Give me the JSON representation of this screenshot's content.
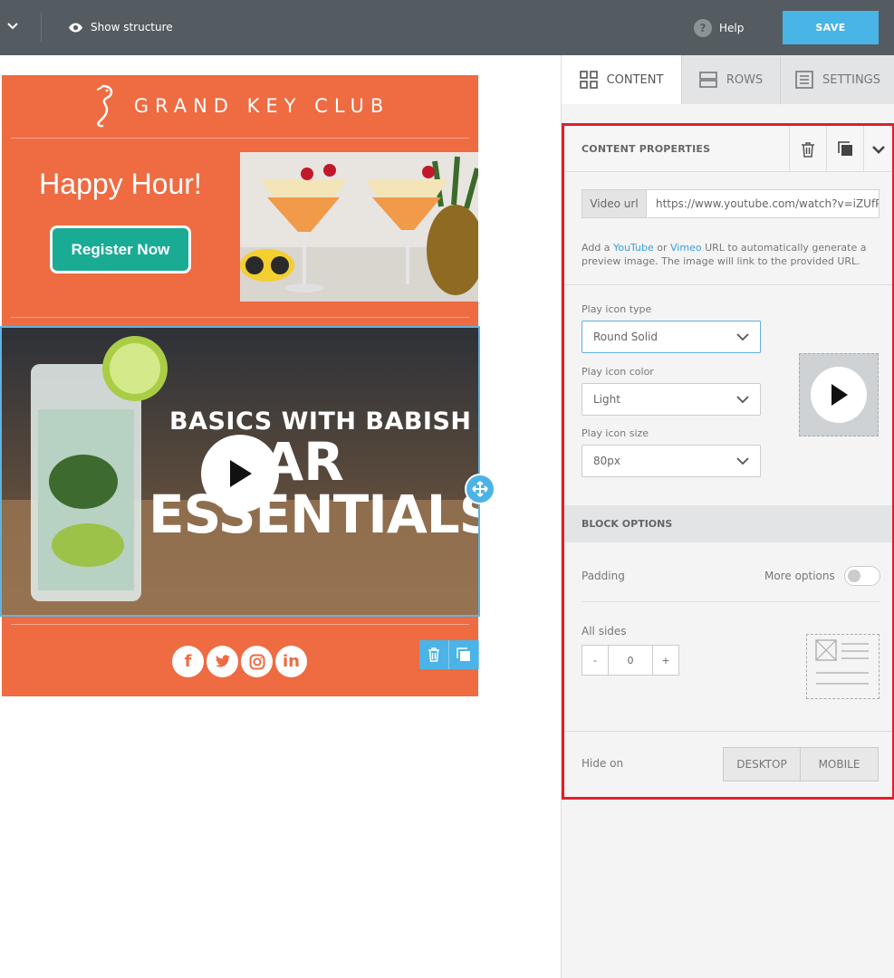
{
  "topbar": {
    "show_structure": "Show structure",
    "help": "Help",
    "save": "SAVE"
  },
  "email": {
    "logo_text": "GRAND KEY CLUB",
    "headline": "Happy Hour!",
    "register_button": "Register Now",
    "video_title_line1": "BASICS WITH BABISH",
    "video_title_line2": "BAR",
    "video_title_line3": "ESSENTIALS",
    "social": [
      "f",
      "t",
      "ig",
      "in"
    ]
  },
  "sidebar": {
    "tabs": [
      {
        "label": "CONTENT",
        "icon": "grid-icon"
      },
      {
        "label": "ROWS",
        "icon": "rows-icon"
      },
      {
        "label": "SETTINGS",
        "icon": "settings-list-icon"
      }
    ],
    "content_properties": "CONTENT PROPERTIES",
    "video_url_label": "Video url",
    "video_url_value": "https://www.youtube.com/watch?v=iZUfPI",
    "help_text_1": "Add a ",
    "help_link_youtube": "YouTube",
    "help_text_2": " or ",
    "help_link_vimeo": "Vimeo",
    "help_text_3": " URL to automatically generate a preview image. The image will link to the provided URL.",
    "play_icon_type_label": "Play icon type",
    "play_icon_type_value": "Round Solid",
    "play_icon_color_label": "Play icon color",
    "play_icon_color_value": "Light",
    "play_icon_size_label": "Play icon size",
    "play_icon_size_value": "80px",
    "block_options": "BLOCK OPTIONS",
    "padding_label": "Padding",
    "more_options": "More options",
    "more_options_on": false,
    "all_sides_label": "All sides",
    "stepper_minus": "-",
    "stepper_value": "0",
    "stepper_plus": "+",
    "hide_on_label": "Hide on",
    "hide_desktop": "DESKTOP",
    "hide_mobile": "MOBILE"
  },
  "colors": {
    "brand_orange": "#ef6b42",
    "accent_blue": "#49b4e6",
    "register_teal": "#1aab95",
    "highlight_red": "#e01f2c"
  }
}
